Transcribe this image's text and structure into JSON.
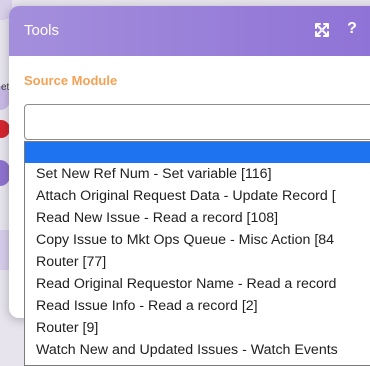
{
  "modal": {
    "title": "Tools",
    "expand_icon": "expand-icon",
    "help_icon": "?",
    "field_label": "Source Module",
    "select_value": ""
  },
  "background": {
    "partial_label": "et"
  },
  "dropdown": {
    "highlighted_option": "",
    "options": [
      "Set New Ref Num - Set variable [116]",
      "Attach Original Request Data - Update Record [",
      "Read New Issue - Read a record [108]",
      "Copy Issue to Mkt Ops Queue - Misc Action [84",
      "Router [77]",
      "Read Original Requestor Name - Read a record",
      "Read Issue Info - Read a record [2]",
      "Router [9]",
      "Watch New and Updated Issues - Watch Events"
    ]
  },
  "colors": {
    "header_accent": "#8f72d6",
    "label_orange": "#f5a154",
    "highlight_blue": "#1e74f0"
  }
}
